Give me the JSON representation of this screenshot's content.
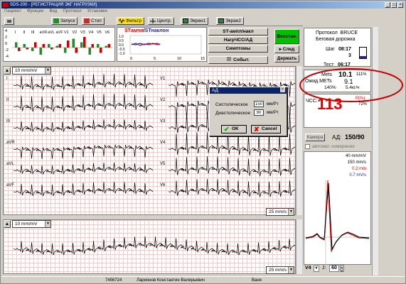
{
  "window": {
    "title": "SDS-200 - [РЕГИСТРАЦИЯ ЭКГ НАГРУЗКИ]"
  },
  "menu": [
    "Пациент",
    "Функции",
    "Вид",
    "Протокол",
    "Установки"
  ],
  "toolbar": {
    "start": "Запуск",
    "stop": "Стоп",
    "filter": "Фильтр",
    "center": "Центр.",
    "screen1": "Экран1",
    "screen2": "Экран2"
  },
  "bar_chart": {
    "leads": [
      "I",
      "II",
      "III",
      "aVR",
      "aVL",
      "aVF",
      "V1",
      "V2",
      "V3",
      "V4",
      "V5",
      "V6"
    ],
    "yticks": [
      "4",
      "2",
      "0",
      "-2",
      "-4"
    ]
  },
  "trend": {
    "title_a": "STампл",
    "title_sep": "/",
    "title_b": "STнаклон",
    "yticks": [
      "1.0",
      "0.5",
      "0.0",
      "-0.5",
      "-1.0"
    ],
    "xticks": [
      "0",
      "5",
      "10",
      "15"
    ]
  },
  "st_buttons": {
    "b1": "ST-ампл/накл",
    "b2": "НагрЧСС/АД",
    "b3": "Симптомы",
    "b4": "Событ."
  },
  "control_buttons": {
    "restore": "Восстан.",
    "next": "След",
    "hold": "Держать"
  },
  "ecg": {
    "gain1": "10 mm/mV",
    "gain2": "10 mm/mV",
    "speed1": "25 mm/s",
    "speed2": "25 mm/s",
    "leads_left": [
      "I",
      "II",
      "III",
      "aVR",
      "aVL",
      "aVF"
    ],
    "leads_right": [
      "V1",
      "V2",
      "V3",
      "V4",
      "V5",
      "V6"
    ]
  },
  "protocol": {
    "label": "Протокол",
    "name": "BRUCE",
    "type": "Беговая дорожка",
    "step_label": "Шаг",
    "step_time": "08:17",
    "step_num": "3",
    "test_label": "Тест",
    "test_time": "06:17"
  },
  "mets": {
    "label": "Mets",
    "value": "10.1",
    "pct": "111%",
    "expected_label": "Ожид.METs",
    "expected": "9.1",
    "pct2": "140%",
    "o2": "5.4кг/ч"
  },
  "hr": {
    "label": "ЧСС:",
    "value": "113",
    "pct": "P(%)",
    "pct2": "72%"
  },
  "bp": {
    "camera": "Камера",
    "label": "АД:",
    "value": "150/90",
    "auto": "автомат. измерение"
  },
  "complex": {
    "gain": "40 mm/mV",
    "speed": "150 mm/s",
    "st1": "0.2 mm",
    "st2": "0.7 mV/s",
    "lead": "V4",
    "j_label": "J:",
    "j_value": "60"
  },
  "dialog": {
    "title": "АД",
    "sys_label": "Систолическое",
    "sys_value": "150",
    "sys_unit": "мм/Рт",
    "dia_label": "Диастолическое",
    "dia_value": "90",
    "dia_unit": "мм/Рт",
    "ok": "OK",
    "cancel": "Cancel"
  },
  "status": {
    "id": "7456724",
    "patient": "Ларионов Константин Валерьевич",
    "page": "Ваня"
  },
  "colors": {
    "accent_red": "#e00000",
    "active_green": "#00c000",
    "trend_blue": "#2020c0",
    "highlight_ellipse": "#cc0000"
  }
}
